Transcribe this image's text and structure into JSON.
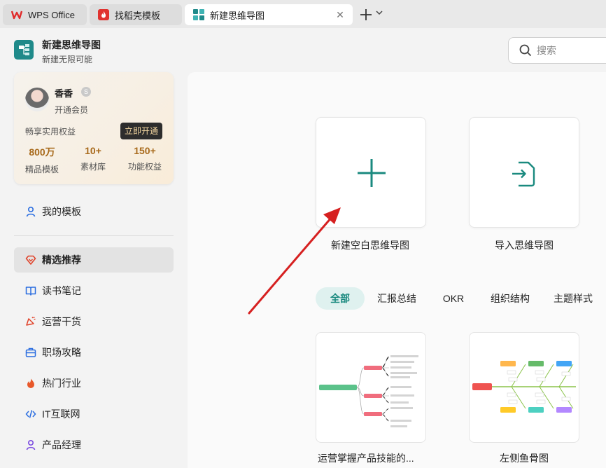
{
  "tabs": [
    {
      "label": "WPS Office",
      "icon": "wps-logo-icon"
    },
    {
      "label": "找稻壳模板",
      "icon": "docer-flame-icon"
    },
    {
      "label": "新建思维导图",
      "icon": "mindmap-app-icon"
    }
  ],
  "header": {
    "title": "新建思维导图",
    "subtitle": "新建无限可能",
    "search_placeholder": "搜索"
  },
  "member": {
    "name": "香香",
    "tier": "开通会员",
    "perks_title": "畅享实用权益",
    "open_button": "立即开通",
    "stats": [
      {
        "value": "800万",
        "label": "精品模板"
      },
      {
        "value": "10+",
        "label": "素材库"
      },
      {
        "value": "150+",
        "label": "功能权益"
      }
    ]
  },
  "sidebar": {
    "my_templates": "我的模板",
    "items": [
      {
        "label": "精选推荐",
        "icon": "diamond-heart-icon",
        "active": true
      },
      {
        "label": "读书笔记",
        "icon": "book-icon"
      },
      {
        "label": "运营干货",
        "icon": "megaphone-icon"
      },
      {
        "label": "职场攻略",
        "icon": "briefcase-icon"
      },
      {
        "label": "热门行业",
        "icon": "flame-icon"
      },
      {
        "label": "IT互联网",
        "icon": "code-icon"
      },
      {
        "label": "产品经理",
        "icon": "user-icon"
      }
    ]
  },
  "actions": {
    "new_blank": "新建空白思维导图",
    "import": "导入思维导图"
  },
  "categories": [
    "全部",
    "汇报总结",
    "OKR",
    "组织结构",
    "主题样式"
  ],
  "templates": [
    {
      "label": "运营掌握产品技能的..."
    },
    {
      "label": "左侧鱼骨图"
    }
  ],
  "colors": {
    "accent": "#1a8a7f",
    "annotation_arrow": "#d62020"
  }
}
